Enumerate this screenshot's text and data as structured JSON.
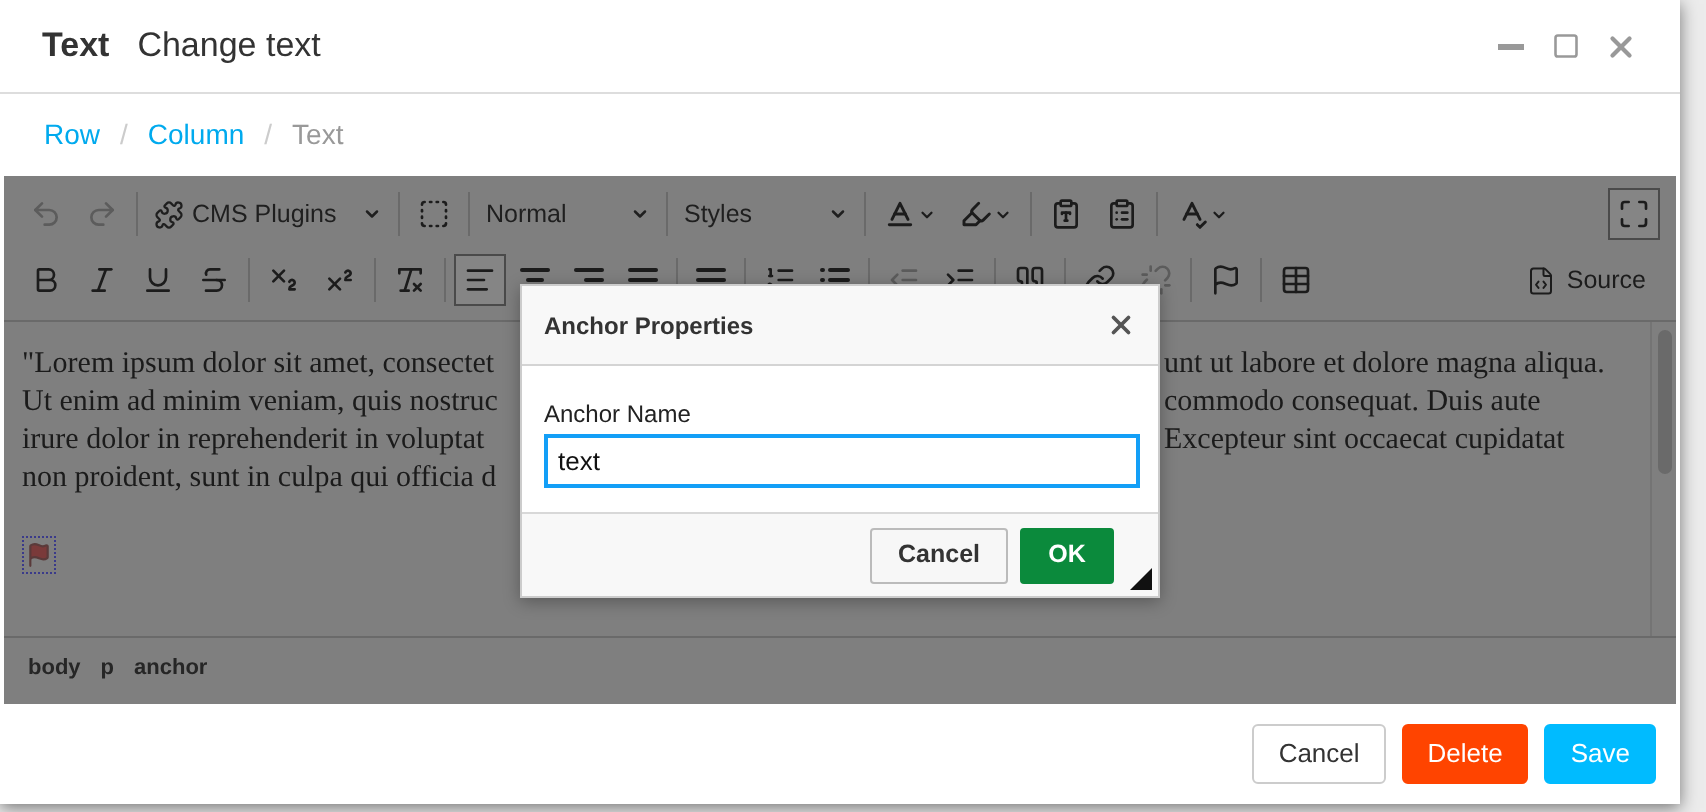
{
  "window": {
    "title": "Text",
    "subtitle": "Change text"
  },
  "breadcrumb": [
    {
      "kind": "link",
      "label": "Row"
    },
    {
      "kind": "separator",
      "label": "/"
    },
    {
      "kind": "link",
      "label": "Column"
    },
    {
      "kind": "separator",
      "label": "/"
    },
    {
      "kind": "current",
      "label": "Text"
    }
  ],
  "toolbar": {
    "rows": [
      {
        "groups": [
          [
            {
              "kind": "button",
              "disabled": true,
              "selected": false
            },
            {
              "kind": "button",
              "disabled": true,
              "selected": false
            }
          ],
          [
            {
              "kind": "dropdown",
              "label": "CMS Plugins"
            }
          ],
          [
            {
              "kind": "button",
              "disabled": false,
              "selected": false
            }
          ],
          [
            {
              "kind": "dropdown",
              "label": "Normal"
            }
          ],
          [
            {
              "kind": "dropdown",
              "label": "Styles"
            }
          ],
          [
            {
              "kind": "menu-button",
              "disabled": false,
              "selected": false
            },
            {
              "kind": "menu-button",
              "disabled": false,
              "selected": false
            }
          ],
          [
            {
              "kind": "button",
              "disabled": false,
              "selected": false
            },
            {
              "kind": "button",
              "disabled": false,
              "selected": false
            }
          ],
          [
            {
              "kind": "menu-button",
              "disabled": false,
              "selected": false
            }
          ]
        ],
        "end": {
          "kind": "button",
          "disabled": false,
          "selected": true
        }
      },
      {
        "groups": [
          [
            {
              "kind": "button",
              "disabled": false,
              "selected": false
            },
            {
              "kind": "button",
              "disabled": false,
              "selected": false
            },
            {
              "kind": "button",
              "disabled": false,
              "selected": false
            },
            {
              "kind": "button",
              "disabled": false,
              "selected": false
            }
          ],
          [
            {
              "kind": "button",
              "disabled": false,
              "selected": false
            },
            {
              "kind": "button",
              "disabled": false,
              "selected": false
            }
          ],
          [
            {
              "kind": "button",
              "disabled": false,
              "selected": false
            }
          ],
          [
            {
              "kind": "button",
              "disabled": false,
              "selected": true
            },
            {
              "kind": "button",
              "disabled": false,
              "selected": false
            },
            {
              "kind": "button",
              "disabled": false,
              "selected": false
            },
            {
              "kind": "button",
              "disabled": false,
              "selected": false
            }
          ],
          [
            {
              "kind": "button",
              "disabled": false,
              "selected": false
            }
          ],
          [
            {
              "kind": "button",
              "disabled": false,
              "selected": false
            },
            {
              "kind": "button",
              "disabled": false,
              "selected": false
            }
          ],
          [
            {
              "kind": "button",
              "disabled": true,
              "selected": false
            },
            {
              "kind": "button",
              "disabled": false,
              "selected": false
            }
          ],
          [
            {
              "kind": "button",
              "disabled": false,
              "selected": false
            }
          ],
          [
            {
              "kind": "button",
              "disabled": false,
              "selected": false
            },
            {
              "kind": "button",
              "disabled": true,
              "selected": false
            }
          ],
          [
            {
              "kind": "button",
              "disabled": false,
              "selected": false
            }
          ],
          [
            {
              "kind": "button",
              "disabled": false,
              "selected": false
            }
          ]
        ],
        "end": {
          "kind": "labeled-button",
          "label": "Source",
          "disabled": false,
          "selected": false
        }
      }
    ]
  },
  "content": {
    "lines": [
      {
        "left": "\"Lorem ipsum dolor sit amet, consectet",
        "right": "unt ut labore et dolore magna aliqua."
      },
      {
        "left": "Ut enim ad minim veniam, quis nostruc",
        "right": "commodo consequat. Duis aute"
      },
      {
        "left": "irure dolor in reprehenderit in voluptat",
        "right": "Excepteur sint occaecat cupidatat"
      },
      {
        "left": "non proident, sunt in culpa qui officia d"
      }
    ]
  },
  "element_path": [
    "body",
    "p",
    "anchor"
  ],
  "dialog": {
    "title": "Anchor Properties",
    "field": {
      "label": "Anchor Name",
      "value": "text",
      "focused": true
    },
    "buttons": [
      {
        "kind": "secondary",
        "label": "Cancel"
      },
      {
        "kind": "primary",
        "label": "OK"
      }
    ]
  },
  "footer": {
    "buttons": [
      {
        "kind": "default",
        "label": "Cancel"
      },
      {
        "kind": "danger",
        "label": "Delete"
      },
      {
        "kind": "primary",
        "label": "Save"
      }
    ]
  }
}
